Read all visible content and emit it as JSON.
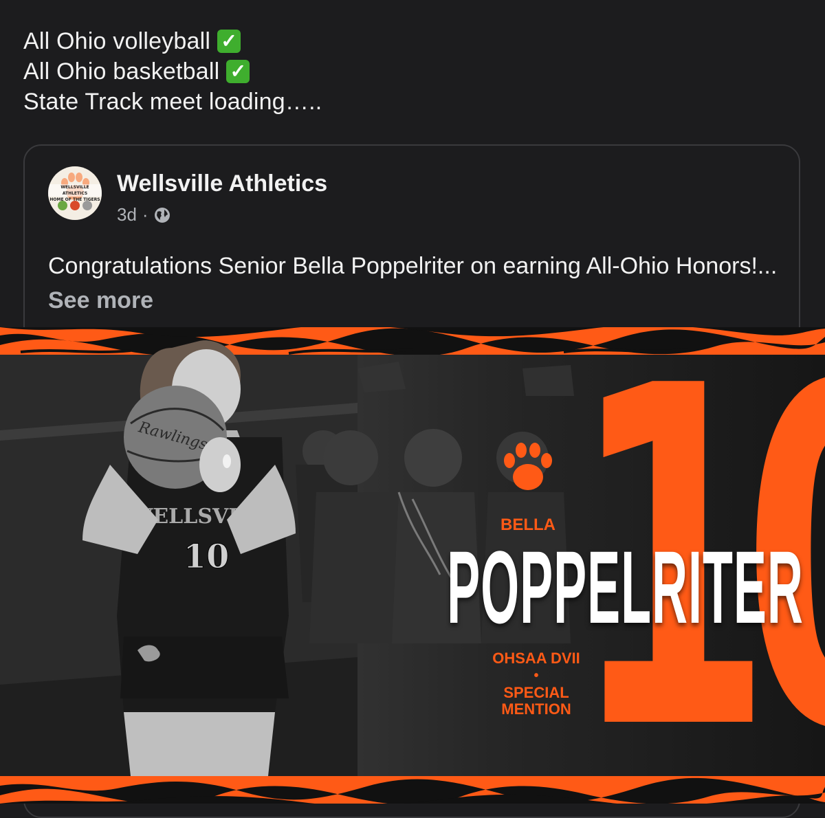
{
  "post": {
    "lines": [
      {
        "text": "All Ohio volleyball",
        "check": "check-mark-icon"
      },
      {
        "text": "All Ohio basketball",
        "check": "check-mark-icon"
      },
      {
        "text": "State Track meet loading…..",
        "check": null
      }
    ]
  },
  "shared": {
    "page_name": "Wellsville Athletics",
    "time": "3d",
    "separator": "·",
    "privacy_icon": "globe-icon",
    "avatar": {
      "line1": "WELLSVILLE ATHLETICS",
      "line2": "HOME OF THE TIGERS"
    },
    "body_text": "Congratulations Senior Bella Poppelriter on earning All-Ohio Honors!...",
    "see_more": "See more"
  },
  "graphic": {
    "jersey_number": "10",
    "first_name": "BELLA",
    "last_name": "POPPELRITER",
    "division": "OHSAA DVII",
    "bullet": "•",
    "honor_line1": "SPECIAL",
    "honor_line2": "MENTION",
    "accent_color": "#ff5a16"
  }
}
